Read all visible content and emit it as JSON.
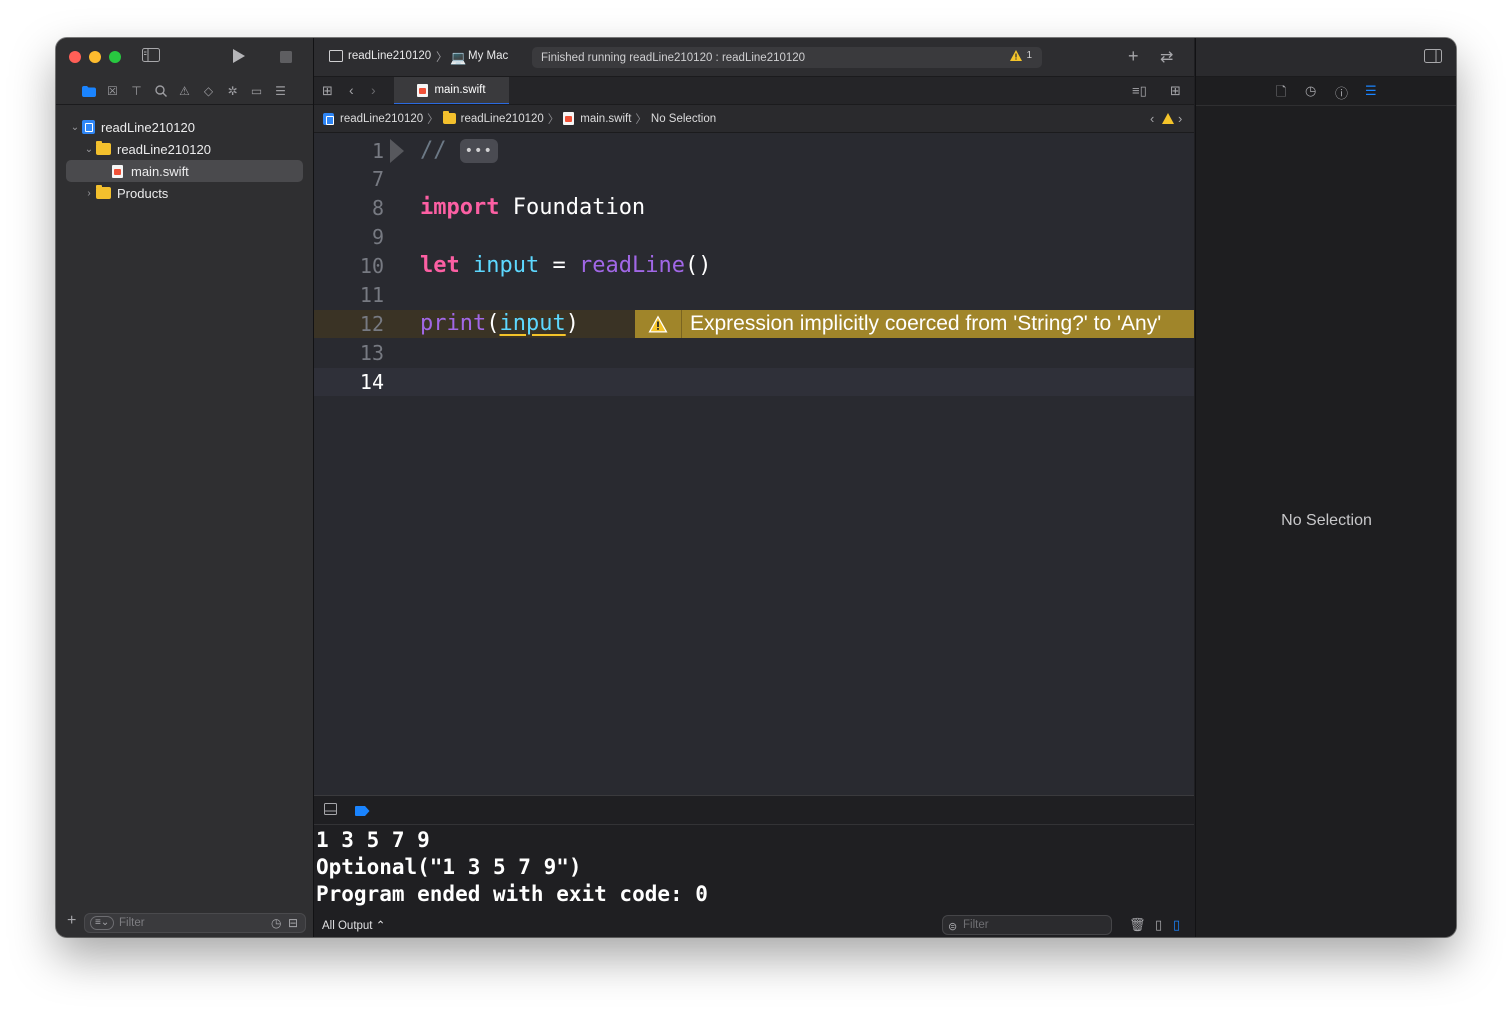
{
  "window": {
    "scheme": "readLine210120",
    "destination": "My Mac",
    "status": "Finished running readLine210120 : readLine210120",
    "warning_count": "1"
  },
  "navigator": {
    "items": [
      {
        "label": "readLine210120",
        "type": "project"
      },
      {
        "label": "readLine210120",
        "type": "folder"
      },
      {
        "label": "main.swift",
        "type": "swift-file"
      },
      {
        "label": "Products",
        "type": "folder"
      }
    ],
    "filter_placeholder": "Filter"
  },
  "editor": {
    "tab": "main.swift",
    "breadcrumb": [
      "readLine210120",
      "readLine210120",
      "main.swift",
      "No Selection"
    ],
    "lines": [
      {
        "num": "1",
        "text": "//"
      },
      {
        "num": "7",
        "text": ""
      },
      {
        "num": "8",
        "kw": "import",
        "rest": " Foundation"
      },
      {
        "num": "9",
        "text": ""
      },
      {
        "num": "10",
        "kw": "let",
        "var": "input",
        "op": " = ",
        "fn": "readLine",
        "tail": "()"
      },
      {
        "num": "11",
        "text": ""
      },
      {
        "num": "12",
        "fn": "print",
        "open": "(",
        "var": "input",
        "close": ")"
      },
      {
        "num": "13",
        "text": ""
      },
      {
        "num": "14",
        "text": ""
      }
    ],
    "fold_marker": "•••",
    "warning_message": "Expression implicitly coerced from 'String?' to 'Any'"
  },
  "console": {
    "output": [
      "1 3 5 7 9",
      "Optional(\"1 3 5 7 9\")",
      "Program ended with exit code: 0"
    ],
    "scope": "All Output",
    "filter_placeholder": "Filter"
  },
  "inspector": {
    "empty_text": "No Selection"
  },
  "colors": {
    "keyword": "#fc5fa3",
    "variable": "#5dd8ff",
    "function": "#a167e6",
    "warning": "#a0852a",
    "accent": "#1a84ff"
  }
}
